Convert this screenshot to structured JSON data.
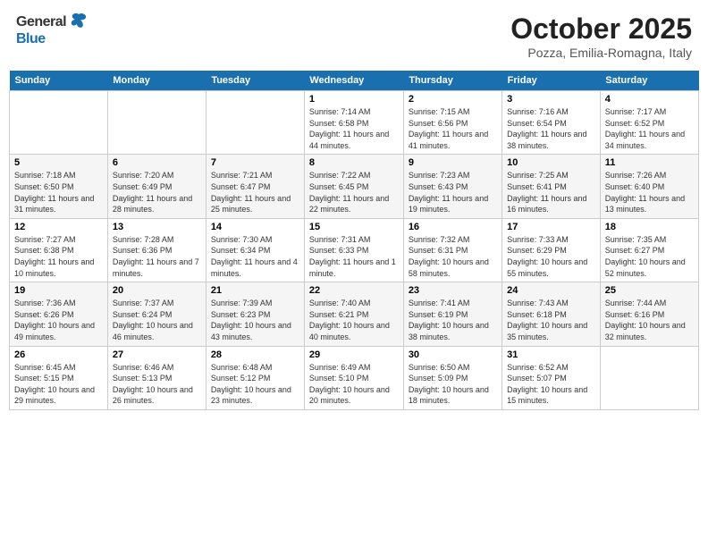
{
  "header": {
    "logo_general": "General",
    "logo_blue": "Blue",
    "month_title": "October 2025",
    "location": "Pozza, Emilia-Romagna, Italy"
  },
  "days_of_week": [
    "Sunday",
    "Monday",
    "Tuesday",
    "Wednesday",
    "Thursday",
    "Friday",
    "Saturday"
  ],
  "weeks": [
    [
      {
        "day": "",
        "info": ""
      },
      {
        "day": "",
        "info": ""
      },
      {
        "day": "",
        "info": ""
      },
      {
        "day": "1",
        "info": "Sunrise: 7:14 AM\nSunset: 6:58 PM\nDaylight: 11 hours and 44 minutes."
      },
      {
        "day": "2",
        "info": "Sunrise: 7:15 AM\nSunset: 6:56 PM\nDaylight: 11 hours and 41 minutes."
      },
      {
        "day": "3",
        "info": "Sunrise: 7:16 AM\nSunset: 6:54 PM\nDaylight: 11 hours and 38 minutes."
      },
      {
        "day": "4",
        "info": "Sunrise: 7:17 AM\nSunset: 6:52 PM\nDaylight: 11 hours and 34 minutes."
      }
    ],
    [
      {
        "day": "5",
        "info": "Sunrise: 7:18 AM\nSunset: 6:50 PM\nDaylight: 11 hours and 31 minutes."
      },
      {
        "day": "6",
        "info": "Sunrise: 7:20 AM\nSunset: 6:49 PM\nDaylight: 11 hours and 28 minutes."
      },
      {
        "day": "7",
        "info": "Sunrise: 7:21 AM\nSunset: 6:47 PM\nDaylight: 11 hours and 25 minutes."
      },
      {
        "day": "8",
        "info": "Sunrise: 7:22 AM\nSunset: 6:45 PM\nDaylight: 11 hours and 22 minutes."
      },
      {
        "day": "9",
        "info": "Sunrise: 7:23 AM\nSunset: 6:43 PM\nDaylight: 11 hours and 19 minutes."
      },
      {
        "day": "10",
        "info": "Sunrise: 7:25 AM\nSunset: 6:41 PM\nDaylight: 11 hours and 16 minutes."
      },
      {
        "day": "11",
        "info": "Sunrise: 7:26 AM\nSunset: 6:40 PM\nDaylight: 11 hours and 13 minutes."
      }
    ],
    [
      {
        "day": "12",
        "info": "Sunrise: 7:27 AM\nSunset: 6:38 PM\nDaylight: 11 hours and 10 minutes."
      },
      {
        "day": "13",
        "info": "Sunrise: 7:28 AM\nSunset: 6:36 PM\nDaylight: 11 hours and 7 minutes."
      },
      {
        "day": "14",
        "info": "Sunrise: 7:30 AM\nSunset: 6:34 PM\nDaylight: 11 hours and 4 minutes."
      },
      {
        "day": "15",
        "info": "Sunrise: 7:31 AM\nSunset: 6:33 PM\nDaylight: 11 hours and 1 minute."
      },
      {
        "day": "16",
        "info": "Sunrise: 7:32 AM\nSunset: 6:31 PM\nDaylight: 10 hours and 58 minutes."
      },
      {
        "day": "17",
        "info": "Sunrise: 7:33 AM\nSunset: 6:29 PM\nDaylight: 10 hours and 55 minutes."
      },
      {
        "day": "18",
        "info": "Sunrise: 7:35 AM\nSunset: 6:27 PM\nDaylight: 10 hours and 52 minutes."
      }
    ],
    [
      {
        "day": "19",
        "info": "Sunrise: 7:36 AM\nSunset: 6:26 PM\nDaylight: 10 hours and 49 minutes."
      },
      {
        "day": "20",
        "info": "Sunrise: 7:37 AM\nSunset: 6:24 PM\nDaylight: 10 hours and 46 minutes."
      },
      {
        "day": "21",
        "info": "Sunrise: 7:39 AM\nSunset: 6:23 PM\nDaylight: 10 hours and 43 minutes."
      },
      {
        "day": "22",
        "info": "Sunrise: 7:40 AM\nSunset: 6:21 PM\nDaylight: 10 hours and 40 minutes."
      },
      {
        "day": "23",
        "info": "Sunrise: 7:41 AM\nSunset: 6:19 PM\nDaylight: 10 hours and 38 minutes."
      },
      {
        "day": "24",
        "info": "Sunrise: 7:43 AM\nSunset: 6:18 PM\nDaylight: 10 hours and 35 minutes."
      },
      {
        "day": "25",
        "info": "Sunrise: 7:44 AM\nSunset: 6:16 PM\nDaylight: 10 hours and 32 minutes."
      }
    ],
    [
      {
        "day": "26",
        "info": "Sunrise: 6:45 AM\nSunset: 5:15 PM\nDaylight: 10 hours and 29 minutes."
      },
      {
        "day": "27",
        "info": "Sunrise: 6:46 AM\nSunset: 5:13 PM\nDaylight: 10 hours and 26 minutes."
      },
      {
        "day": "28",
        "info": "Sunrise: 6:48 AM\nSunset: 5:12 PM\nDaylight: 10 hours and 23 minutes."
      },
      {
        "day": "29",
        "info": "Sunrise: 6:49 AM\nSunset: 5:10 PM\nDaylight: 10 hours and 20 minutes."
      },
      {
        "day": "30",
        "info": "Sunrise: 6:50 AM\nSunset: 5:09 PM\nDaylight: 10 hours and 18 minutes."
      },
      {
        "day": "31",
        "info": "Sunrise: 6:52 AM\nSunset: 5:07 PM\nDaylight: 10 hours and 15 minutes."
      },
      {
        "day": "",
        "info": ""
      }
    ]
  ]
}
